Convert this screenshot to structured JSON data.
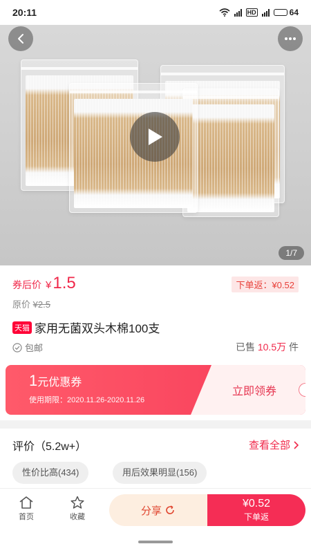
{
  "status": {
    "time": "20:11",
    "battery": "64",
    "network": "HD"
  },
  "hero": {
    "counter": "1/7"
  },
  "product": {
    "price_label": "券后价",
    "currency": "¥",
    "price": "1.5",
    "rebate_badge": "下单返：¥0.52",
    "orig_label": "原价",
    "orig_price": "¥2.5",
    "store_tag": "天猫",
    "title": "家用无菌双头木棉100支",
    "shipping": "包邮",
    "sold_prefix": "已售",
    "sold_count": "10.5万",
    "sold_suffix": "件"
  },
  "coupon": {
    "amount": "1",
    "amount_suffix": "元优惠券",
    "validity": "使用期限：2020.11.26-2020.11.26",
    "action": "立即领券"
  },
  "reviews": {
    "heading": "评价（5.2w+）",
    "view_all": "查看全部",
    "tags": [
      "性价比高(434)",
      "用后效果明显(156)"
    ]
  },
  "bottom_nav": {
    "home_label": "首页",
    "favorite_label": "收藏",
    "share_label": "分享",
    "order_amount": "¥0.52",
    "order_label": "下单返"
  },
  "colors": {
    "accent": "#f0284a",
    "coupon_bg": "#f73d5a",
    "share_bg": "#fdeee0"
  }
}
